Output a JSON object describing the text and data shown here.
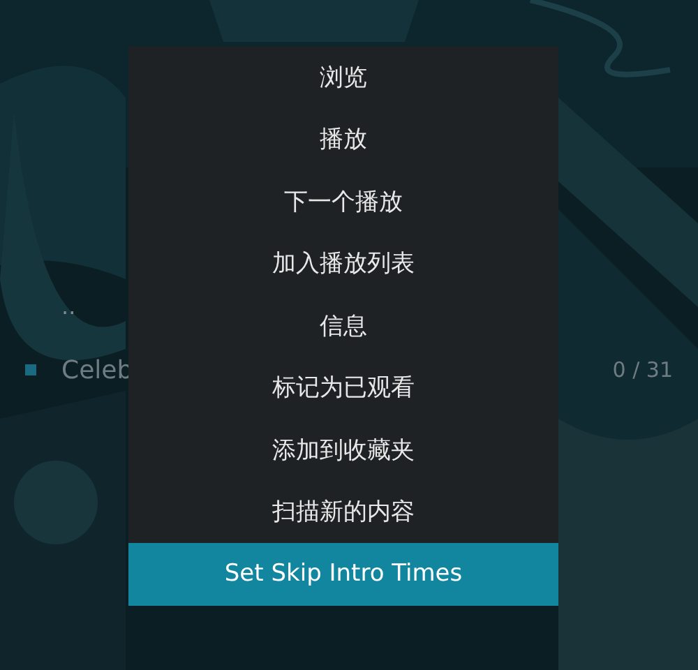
{
  "list": {
    "items": [
      {
        "kind": "parent",
        "label": ".."
      },
      {
        "kind": "folder",
        "label": "Celeb",
        "count": "0 / 31"
      }
    ]
  },
  "context_menu": {
    "items": [
      {
        "label": "浏览",
        "selected": false
      },
      {
        "label": "播放",
        "selected": false
      },
      {
        "label": "下一个播放",
        "selected": false
      },
      {
        "label": "加入播放列表",
        "selected": false
      },
      {
        "label": "信息",
        "selected": false
      },
      {
        "label": "标记为已观看",
        "selected": false
      },
      {
        "label": "添加到收藏夹",
        "selected": false
      },
      {
        "label": "扫描新的内容",
        "selected": false
      },
      {
        "label": "Set Skip Intro Times",
        "selected": true
      }
    ]
  }
}
